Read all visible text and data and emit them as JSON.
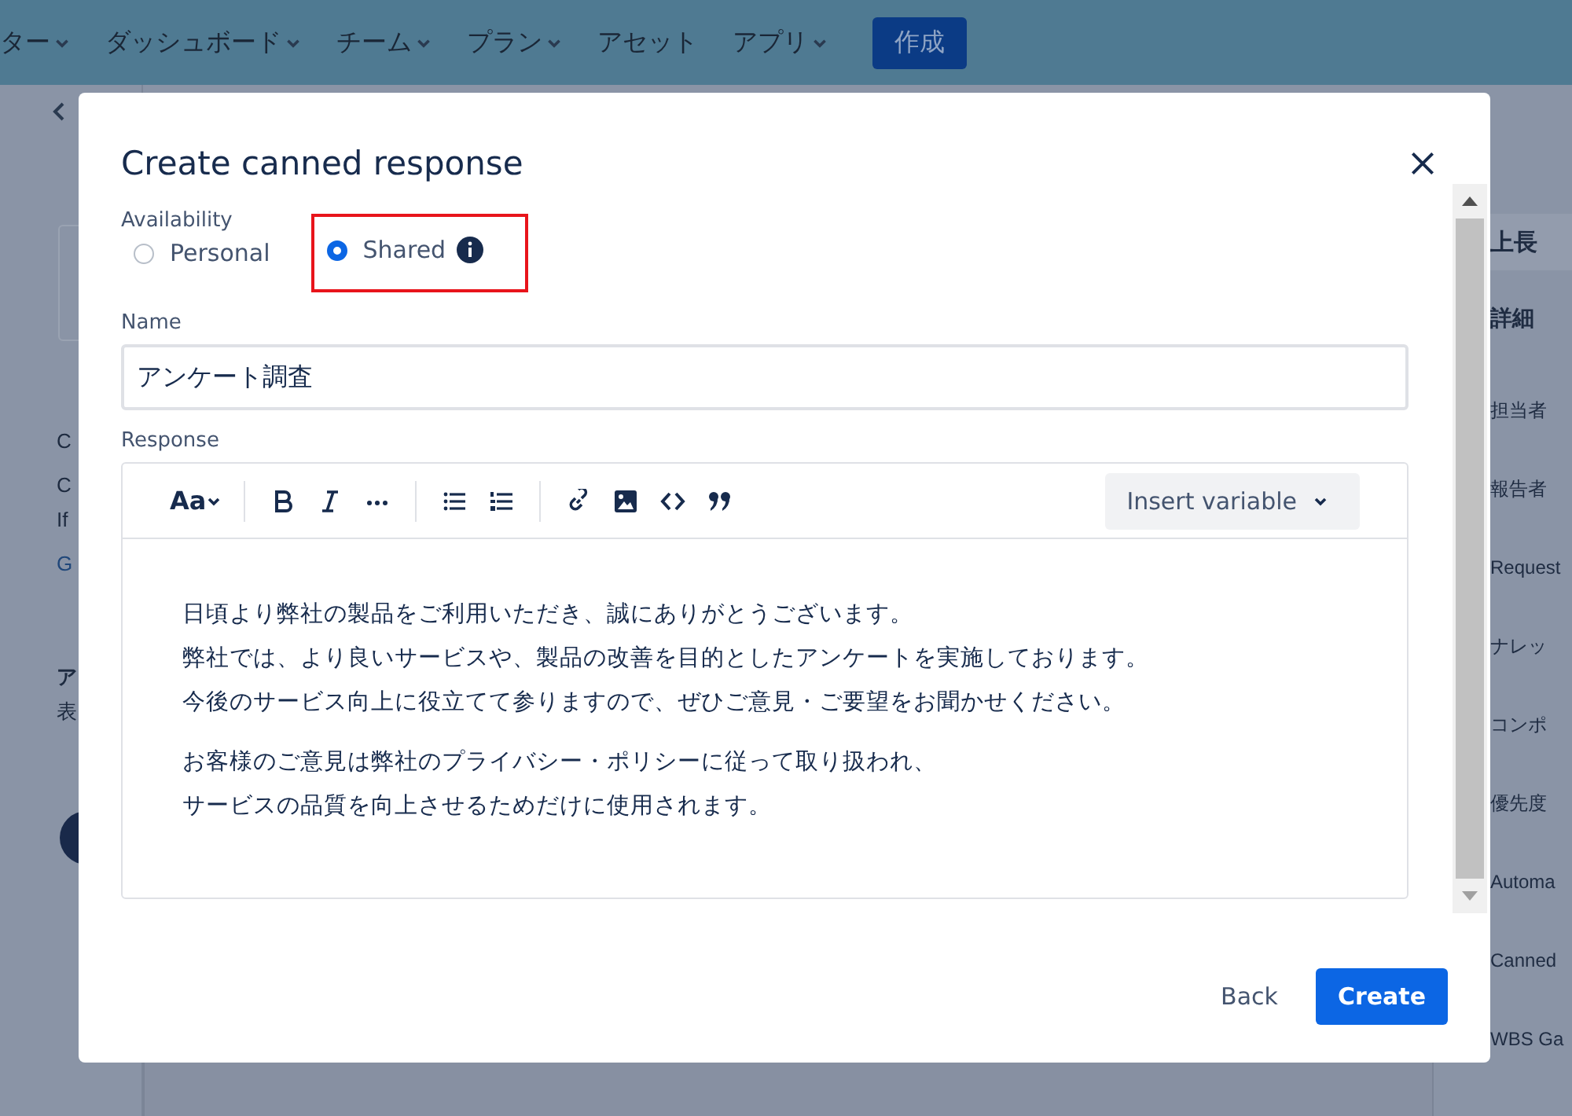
{
  "nav": {
    "items": [
      {
        "label": "ター",
        "dropdown": true
      },
      {
        "label": "ダッシュボード",
        "dropdown": true
      },
      {
        "label": "チーム",
        "dropdown": true
      },
      {
        "label": "プラン",
        "dropdown": true
      },
      {
        "label": "アセット",
        "dropdown": false
      },
      {
        "label": "アプリ",
        "dropdown": true
      }
    ],
    "create_button": "作成"
  },
  "left_panel": {
    "texts": [
      {
        "text": "C",
        "kind": "heading"
      },
      {
        "text": "C",
        "kind": "text"
      },
      {
        "text": "If",
        "kind": "text"
      },
      {
        "text": "G",
        "kind": "link"
      },
      {
        "text": "ア",
        "kind": "bold"
      },
      {
        "text": "表",
        "kind": "text"
      }
    ]
  },
  "right_panel": {
    "items": [
      {
        "label": "上長",
        "kind": "dropdown"
      },
      {
        "label": "詳細",
        "kind": "bold"
      },
      {
        "label": "担当者",
        "kind": "field"
      },
      {
        "label": "報告者",
        "kind": "field"
      },
      {
        "label": "Request",
        "kind": "field"
      },
      {
        "label": "ナレッ",
        "kind": "field"
      },
      {
        "label": "コンポ",
        "kind": "field"
      },
      {
        "label": "優先度",
        "kind": "field"
      },
      {
        "label": "Automa",
        "kind": "field"
      },
      {
        "label": "Canned",
        "kind": "field"
      },
      {
        "label": "WBS Ga",
        "kind": "field"
      }
    ]
  },
  "modal": {
    "title": "Create canned response",
    "availability": {
      "label": "Availability",
      "options": [
        {
          "label": "Personal",
          "selected": false
        },
        {
          "label": "Shared",
          "selected": true
        }
      ]
    },
    "name": {
      "label": "Name",
      "value": "アンケート調査"
    },
    "response": {
      "label": "Response",
      "insert_variable": "Insert variable",
      "toolbar_font": "Aa",
      "paragraphs": [
        [
          "日頃より弊社の製品をご利用いただき、誠にありがとうございます。",
          "弊社では、より良いサービスや、製品の改善を目的としたアンケートを実施しております。",
          "今後のサービス向上に役立てて参りますので、ぜひご意見・ご要望をお聞かせください。"
        ],
        [
          "お客様のご意見は弊社のプライバシー・ポリシーに従って取り扱われ、",
          "サービスの品質を向上させるためだけに使用されます。"
        ]
      ]
    },
    "buttons": [
      {
        "label": "Back",
        "kind": "subtle"
      },
      {
        "label": "Create",
        "kind": "primary"
      }
    ]
  }
}
